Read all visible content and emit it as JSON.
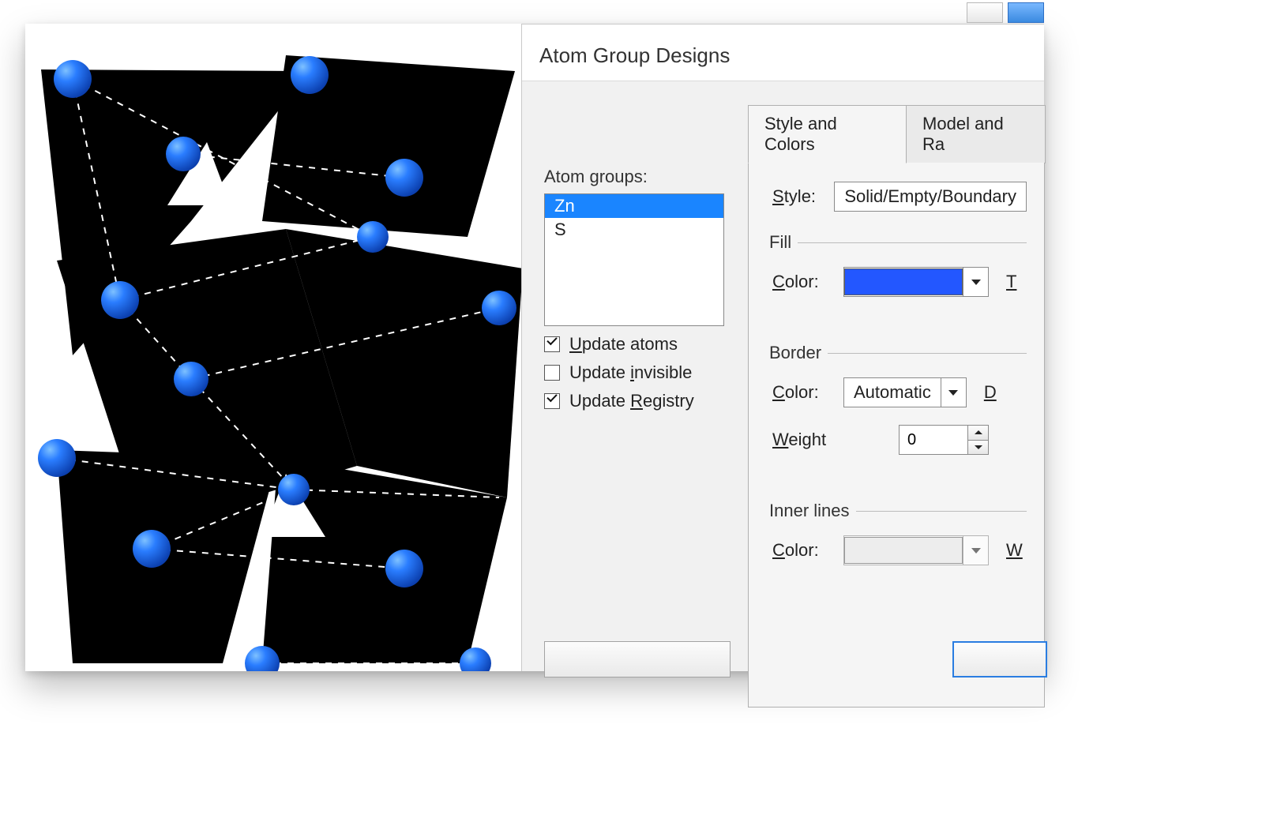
{
  "dialog": {
    "title": "Atom Group Designs",
    "atom_groups_label": "Atom groups:",
    "atom_groups": [
      "Zn",
      "S"
    ],
    "selected_group_index": 0,
    "checks": {
      "update_atoms": {
        "checked": true
      },
      "update_invisible": {
        "checked": false
      },
      "update_registry": {
        "checked": true
      }
    },
    "tabs": {
      "style_and_colors": "Style and Colors",
      "model_and_ra": "Model and Ra"
    },
    "style": {
      "label": "Style:",
      "value": "Solid/Empty/Boundary"
    },
    "fill": {
      "legend": "Fill",
      "color_label": "Color:",
      "color": "#2357ff",
      "trail": "T"
    },
    "border": {
      "legend": "Border",
      "color_label": "Color:",
      "color_value": "Automatic",
      "trail": "D",
      "weight_label": "Weight",
      "weight_value": "0"
    },
    "inner": {
      "legend": "Inner lines",
      "color_label": "Color:",
      "trail": "W"
    }
  }
}
